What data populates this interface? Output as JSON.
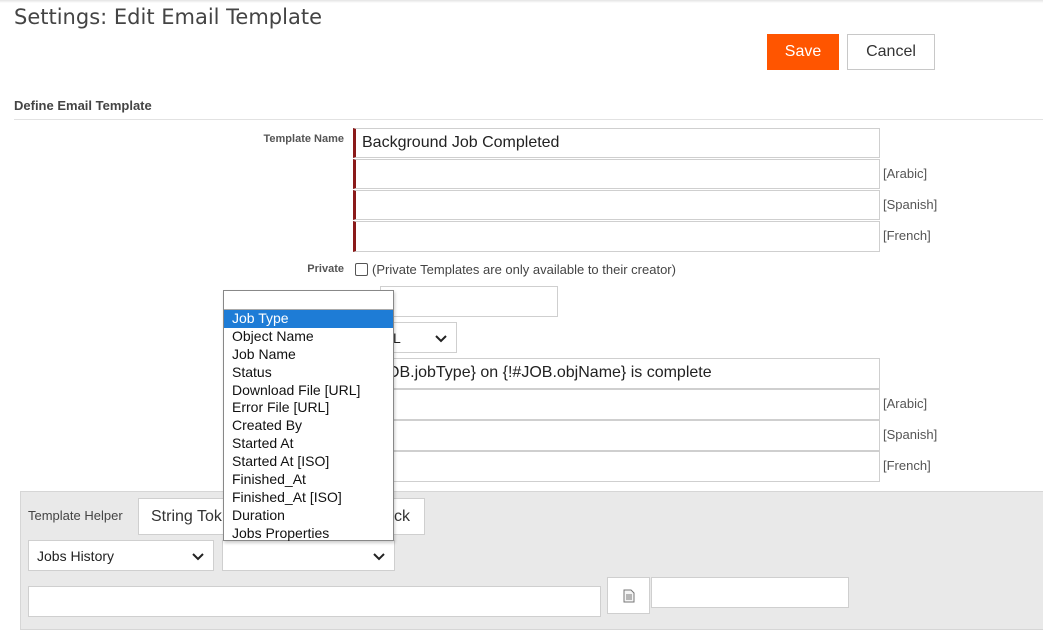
{
  "header": {
    "title": "Settings: Edit Email Template",
    "save_label": "Save",
    "cancel_label": "Cancel"
  },
  "section": {
    "title": "Define Email Template"
  },
  "template_name": {
    "label": "Template Name",
    "value": "Background Job Completed",
    "translations": [
      {
        "lang": "[Arabic]",
        "value": ""
      },
      {
        "lang": "[Spanish]",
        "value": ""
      },
      {
        "lang": "[French]",
        "value": ""
      }
    ]
  },
  "private": {
    "label": "Private",
    "note": "(Private Templates are only available to their creator)",
    "checked": false
  },
  "partial_fields": {
    "format_select_value": "L",
    "subject_value": "OB.jobType} on {!#JOB.objName} is complete",
    "subject_translations": [
      {
        "lang": "[Arabic]",
        "value": ""
      },
      {
        "lang": "[Spanish]",
        "value": ""
      },
      {
        "lang": "[French]",
        "value": ""
      }
    ]
  },
  "helper": {
    "label": "Template Helper",
    "tab_1_label": "String Tok",
    "tab_2_label": "ck",
    "object_select_value": "Jobs History",
    "field_select_value": ""
  },
  "dropdown": {
    "search_value": "",
    "items": [
      "Job Type",
      "Object Name",
      "Job Name",
      "Status",
      "Download File [URL]",
      "Error File [URL]",
      "Created By",
      "Started At",
      "Started At [ISO]",
      "Finished_At",
      "Finished_At [ISO]",
      "Duration",
      "Jobs Properties"
    ],
    "selected_index": 0
  },
  "colors": {
    "accent": "#ff5500",
    "required_marker": "#8b1a1a",
    "selection": "#1e7cd6"
  }
}
